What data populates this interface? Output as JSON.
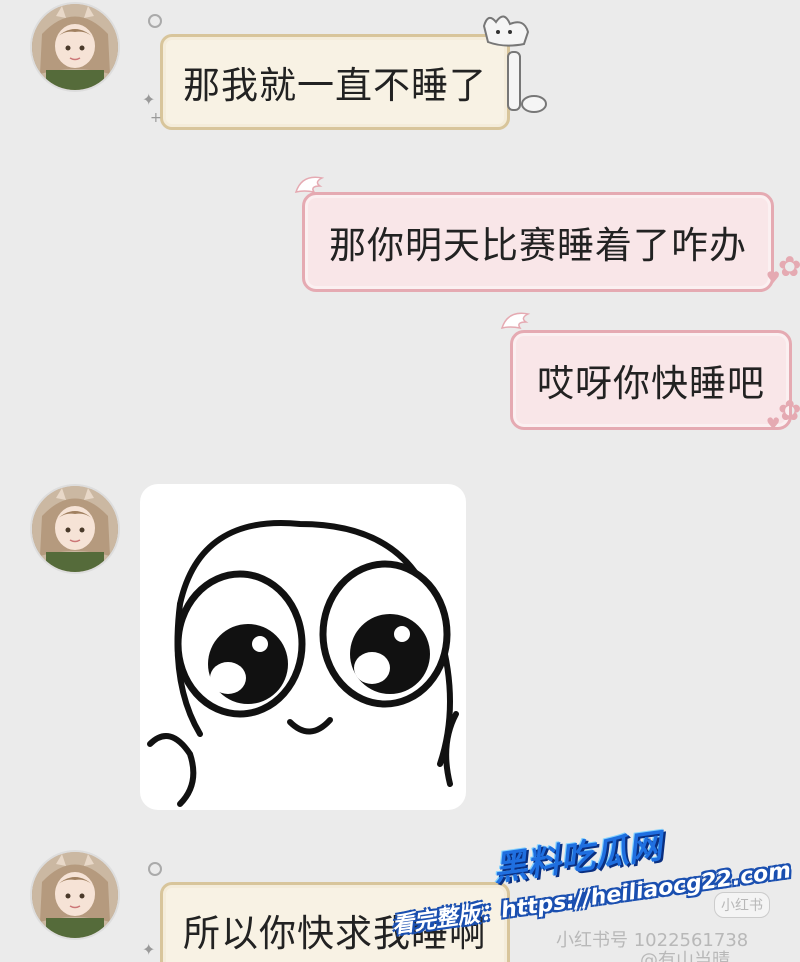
{
  "messages": [
    {
      "side": "in",
      "type": "text",
      "text": "那我就一直不睡了"
    },
    {
      "side": "out",
      "type": "text",
      "text": "那你明天比赛睡着了咋办"
    },
    {
      "side": "out",
      "type": "text",
      "text": "哎呀你快睡吧"
    },
    {
      "side": "in",
      "type": "sticker",
      "icon": "cute-face-sticker"
    },
    {
      "side": "in",
      "type": "text",
      "text": "所以你快求我睡啊"
    }
  ],
  "watermark": {
    "logo": "黑料吃瓜网",
    "url_prefix": "看完整版：",
    "url": "https://heiliaocg22.com"
  },
  "platform_marks": {
    "badge": "小红书",
    "id_line": "小红书号 1022561738",
    "user_line": "@有山当晴"
  },
  "colors": {
    "background": "#ebebeb",
    "incoming_bubble": "#f8f2e4",
    "incoming_border": "#d8c59b",
    "outgoing_bubble": "#f9e6e8",
    "outgoing_border": "#e5aab2"
  }
}
